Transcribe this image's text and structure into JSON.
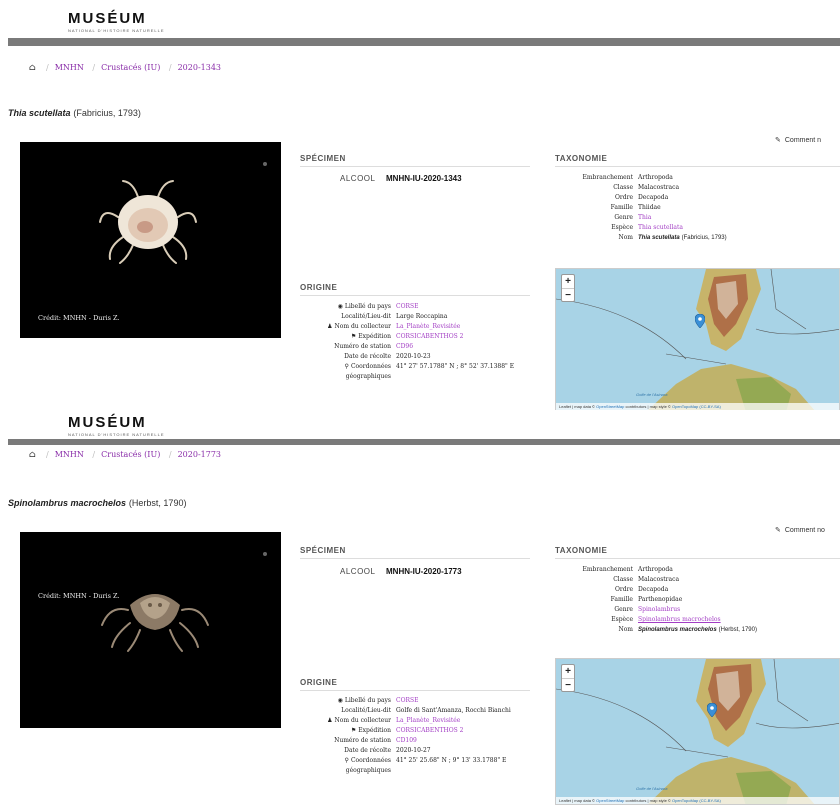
{
  "records": [
    {
      "logo": "MUSÉUM",
      "logo_sub": "NATIONAL D'HISTOIRE NATURELLE",
      "breadcrumb": [
        "MNHN",
        "Crustacés (IU)",
        "2020-1343"
      ],
      "species": {
        "name": "Thia scutellata",
        "author": "(Fabricius, 1793)"
      },
      "comment_label": "Comment n",
      "photo_credit": "Crédit: MNHN - Duris Z.",
      "specimen": {
        "title": "SPÉCIMEN",
        "label": "ALCOOL",
        "id": "MNHN-IU-2020-1343"
      },
      "origin": {
        "title": "ORIGINE",
        "rows": [
          {
            "k": "Libellé du pays",
            "v": "CORSE",
            "link": true,
            "icon": "globe"
          },
          {
            "k": "Localité/Lieu-dit",
            "v": "Large Roccapina",
            "link": false,
            "icon": ""
          },
          {
            "k": "Nom du collecteur",
            "v": "La_Planète_Revisitée",
            "link": true,
            "icon": "user"
          },
          {
            "k": "Expédition",
            "v": "CORSICABENTHOS 2",
            "link": true,
            "icon": "flag"
          },
          {
            "k": "Numéro de station",
            "v": "CD96",
            "link": true,
            "icon": ""
          },
          {
            "k": "Date de récolte",
            "v": "2020-10-23",
            "link": false,
            "icon": ""
          },
          {
            "k": "Coordonnées",
            "v": "41° 27' 57.1788\" N ; 8° 52' 37.1388\" E",
            "link": false,
            "icon": "pin"
          },
          {
            "k": "géographiques",
            "v": "",
            "link": false,
            "icon": ""
          }
        ]
      },
      "taxonomy": {
        "title": "TAXONOMIE",
        "rows": [
          {
            "k": "Embranchement",
            "v": "Arthropoda",
            "link": false
          },
          {
            "k": "Classe",
            "v": "Malacostraca",
            "link": false
          },
          {
            "k": "Ordre",
            "v": "Decapoda",
            "link": false
          },
          {
            "k": "Famille",
            "v": "Thiidae",
            "link": false
          },
          {
            "k": "Genre",
            "v": "Thia",
            "link": true
          },
          {
            "k": "Espèce",
            "v": "Thia scutellata",
            "link": true
          },
          {
            "k": "Nom",
            "v": "Thia scutellata",
            "author": "(Fabricius, 1793)",
            "sci": true
          }
        ]
      },
      "map": {
        "zoom_in": "+",
        "zoom_out": "−",
        "sea_label": "Golfe de l'Asinara",
        "attribution_pre": "Leaflet | map data ©",
        "attribution_osm": "OpenStreetMap",
        "attribution_mid": "contributors | map style ©",
        "attribution_otm": "OpenTopoMap",
        "attribution_post": "(CC-BY-SA)",
        "marker": [
          0.51,
          0.42
        ]
      }
    },
    {
      "logo": "MUSÉUM",
      "logo_sub": "NATIONAL D'HISTOIRE NATURELLE",
      "breadcrumb": [
        "MNHN",
        "Crustacés (IU)",
        "2020-1773"
      ],
      "species": {
        "name": "Spinolambrus macrochelos",
        "author": "(Herbst, 1790)"
      },
      "comment_label": "Comment no",
      "photo_credit": "Crédit: MNHN - Duris Z.",
      "specimen": {
        "title": "SPÉCIMEN",
        "label": "ALCOOL",
        "id": "MNHN-IU-2020-1773"
      },
      "origin": {
        "title": "ORIGINE",
        "rows": [
          {
            "k": "Libellé du pays",
            "v": "CORSE",
            "link": true,
            "icon": "globe"
          },
          {
            "k": "Localité/Lieu-dit",
            "v": "Golfe di Sant'Amanza, Rocchi Bianchi",
            "link": false,
            "icon": ""
          },
          {
            "k": "Nom du collecteur",
            "v": "La_Planète_Revisitée",
            "link": true,
            "icon": "user"
          },
          {
            "k": "Expédition",
            "v": "CORSICABENTHOS 2",
            "link": true,
            "icon": "flag"
          },
          {
            "k": "Numéro de station",
            "v": "CD109",
            "link": true,
            "icon": ""
          },
          {
            "k": "Date de récolte",
            "v": "2020-10-27",
            "link": false,
            "icon": ""
          },
          {
            "k": "Coordonnées",
            "v": "41° 25' 25.68\" N ; 9° 13' 33.1788\" E",
            "link": false,
            "icon": "pin"
          },
          {
            "k": "géographiques",
            "v": "",
            "link": false,
            "icon": ""
          }
        ]
      },
      "taxonomy": {
        "title": "TAXONOMIE",
        "rows": [
          {
            "k": "Embranchement",
            "v": "Arthropoda",
            "link": false
          },
          {
            "k": "Classe",
            "v": "Malacostraca",
            "link": false
          },
          {
            "k": "Ordre",
            "v": "Decapoda",
            "link": false
          },
          {
            "k": "Famille",
            "v": "Parthenopidae",
            "link": false
          },
          {
            "k": "Genre",
            "v": "Spinolambrus",
            "link": true
          },
          {
            "k": "Espèce",
            "v": "Spinolambrus macrochelos",
            "link": true,
            "underline": true
          },
          {
            "k": "Nom",
            "v": "Spinolambrus macrochelos",
            "author": "(Herbst, 1790)",
            "sci": true
          }
        ]
      },
      "map": {
        "zoom_in": "+",
        "zoom_out": "−",
        "sea_label": "Golfe de l'Asinara",
        "attribution_pre": "Leaflet | map data ©",
        "attribution_osm": "OpenStreetMap",
        "attribution_mid": "contributors | map style ©",
        "attribution_otm": "OpenTopoMap",
        "attribution_post": "(CC-BY-SA)",
        "marker": [
          0.55,
          0.4
        ]
      }
    }
  ],
  "colors": {
    "link": "#a23dc4",
    "bar": "#7a7a7a",
    "sea": "#a8d3e6",
    "marker": "#3a8fd6"
  },
  "icons": {
    "home": "home-icon",
    "edit": "pencil-icon",
    "globe": "globe-icon",
    "user": "user-icon",
    "flag": "flag-icon",
    "pin": "map-pin-icon"
  }
}
